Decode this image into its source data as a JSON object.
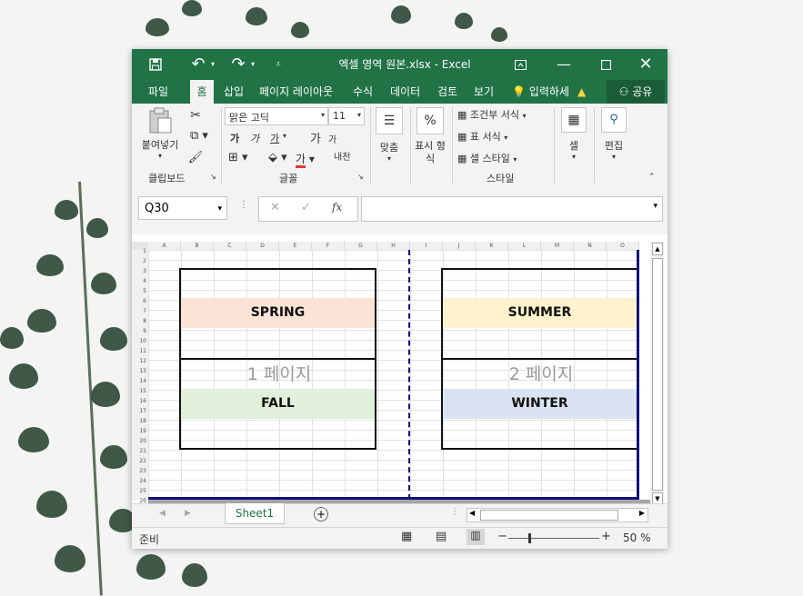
{
  "title": "엑셀 영역 원본.xlsx - Excel",
  "tabs": [
    "파일",
    "홈",
    "삽입",
    "페이지 레이아웃",
    "수식",
    "데이터",
    "검토",
    "보기"
  ],
  "active_tab": "홈",
  "tell_me": "입력하세",
  "share": "공유",
  "ribbon": {
    "paste": "붙여넣기",
    "clipboard": "클립보드",
    "font_name": "맑은 고딕",
    "font_size": "11",
    "font_group": "글꼴",
    "bold": "가",
    "italic": "가",
    "underline": "가",
    "grow": "가",
    "shrink": "가",
    "phonetic": "내천",
    "align": "맞춤",
    "number": "표시 형식",
    "cond_format": "조건부 서식",
    "table_format": "표 서식",
    "cell_style": "셀 스타일",
    "styles_group": "스타일",
    "cells": "셀",
    "editing": "편집",
    "percent": "%"
  },
  "namebox": "Q30",
  "columns": [
    "A",
    "B",
    "C",
    "D",
    "E",
    "F",
    "G",
    "H",
    "I",
    "J",
    "K",
    "L",
    "M",
    "N",
    "O"
  ],
  "rows": [
    "1",
    "2",
    "3",
    "4",
    "5",
    "6",
    "7",
    "8",
    "9",
    "10",
    "11",
    "12",
    "13",
    "14",
    "15",
    "16",
    "17",
    "18",
    "19",
    "20",
    "21",
    "22",
    "23",
    "24",
    "25",
    "26"
  ],
  "labels": {
    "spring": "SPRING",
    "summer": "SUMMER",
    "fall": "FALL",
    "winter": "WINTER",
    "page1": "1 페이지",
    "page2": "2 페이지"
  },
  "colors": {
    "spring": "#fbe4d6",
    "summer": "#fff2cc",
    "fall": "#e2efda",
    "winter": "#dae3f3",
    "brand": "#217346"
  },
  "sheet_tab": "Sheet1",
  "status": {
    "ready": "준비",
    "zoom": "50 %"
  }
}
